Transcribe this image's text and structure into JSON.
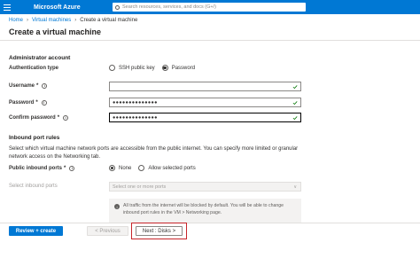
{
  "topbar": {
    "brand": "Microsoft Azure",
    "search_placeholder": "Search resources, services, and docs (G+/)"
  },
  "breadcrumb": {
    "items": [
      "Home",
      "Virtual machines",
      "Create a virtual machine"
    ]
  },
  "page_title": "Create a virtual machine",
  "admin": {
    "heading": "Administrator account",
    "auth_type_label": "Authentication type",
    "auth_options": [
      "SSH public key",
      "Password"
    ],
    "auth_selected": "Password",
    "username_label": "Username",
    "username_value": "",
    "password_label": "Password",
    "password_value": "●●●●●●●●●●●●●●",
    "confirm_label": "Confirm password",
    "confirm_value": "●●●●●●●●●●●●●●",
    "required_mark": "*"
  },
  "inbound": {
    "heading": "Inbound port rules",
    "description": "Select which virtual machine network ports are accessible from the public internet. You can specify more limited or granular network access on the Networking tab.",
    "public_ports_label": "Public inbound ports",
    "public_ports_options": [
      "None",
      "Allow selected ports"
    ],
    "public_ports_selected": "None",
    "select_ports_label": "Select inbound ports",
    "select_ports_placeholder": "Select one or more ports",
    "info_text": "All traffic from the internet will be blocked by default. You will be able to change inbound port rules in the VM > Networking page."
  },
  "footer": {
    "review_create": "Review + create",
    "previous": "< Previous",
    "next": "Next : Disks >"
  },
  "colors": {
    "accent": "#0078d4",
    "valid_check": "#107c10",
    "highlight": "#c7252b"
  },
  "icons": {
    "info": "info-icon",
    "check": "checkmark-icon",
    "search": "search-icon",
    "menu": "hamburger-icon"
  }
}
